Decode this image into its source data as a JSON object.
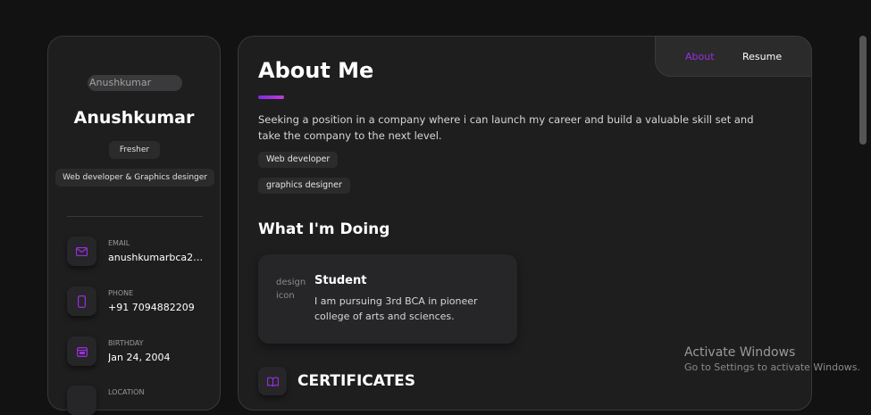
{
  "sidebar": {
    "avatar_alt": "Anushkumar",
    "name": "Anushkumar",
    "status": "Fresher",
    "title": "Web developer & Graphics desinger",
    "contacts": [
      {
        "label": "EMAIL",
        "value": "anushkumarbca212...",
        "icon": "mail-icon"
      },
      {
        "label": "PHONE",
        "value": "+91 7094882209",
        "icon": "phone-icon"
      },
      {
        "label": "BIRTHDAY",
        "value": "Jan 24, 2004",
        "icon": "calendar-icon"
      },
      {
        "label": "LOCATION",
        "value": "",
        "icon": "location-icon"
      }
    ]
  },
  "nav": {
    "about": "About",
    "resume": "Resume"
  },
  "main": {
    "heading": "About Me",
    "about_text": "Seeking a position in a company where i can launch my career and build a valuable skill set and take the company to the next level.",
    "tags": [
      "Web developer",
      "graphics designer"
    ],
    "doing_heading": "What I'm Doing",
    "service": {
      "icon_alt": "design icon",
      "title": "Student",
      "text": "I am pursuing 3rd BCA in pioneer college of arts and sciences."
    },
    "certificates_heading": "CERTIFICATES"
  },
  "watermark": {
    "title": "Activate Windows",
    "subtitle": "Go to Settings to activate Windows."
  },
  "colors": {
    "accent": "#9a2ee0",
    "background": "#121212",
    "card": "#1e1e1f"
  }
}
